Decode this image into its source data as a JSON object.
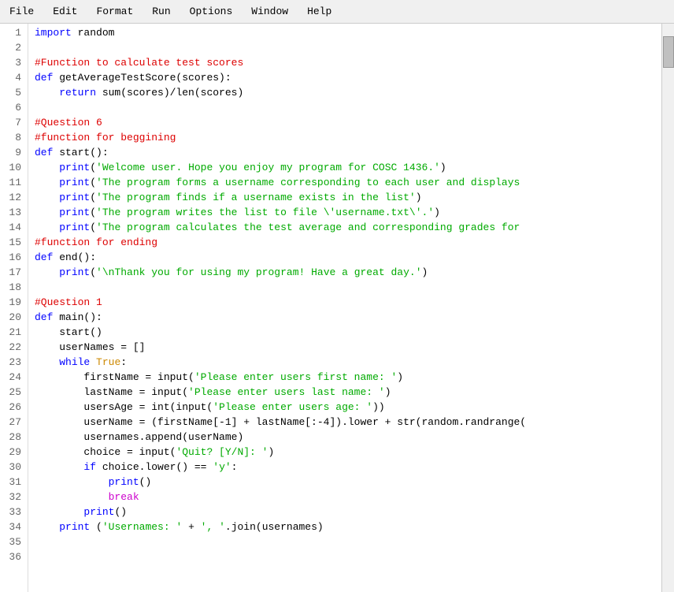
{
  "menubar": {
    "items": [
      "File",
      "Edit",
      "Format",
      "Run",
      "Options",
      "Window",
      "Help"
    ]
  },
  "editor": {
    "lines": [
      {
        "num": 1,
        "tokens": [
          {
            "type": "kw-blue",
            "text": "import"
          },
          {
            "type": "fn-black",
            "text": " random"
          }
        ]
      },
      {
        "num": 2,
        "tokens": []
      },
      {
        "num": 3,
        "tokens": [
          {
            "type": "comment-red",
            "text": "#Function to calculate test scores"
          }
        ]
      },
      {
        "num": 4,
        "tokens": [
          {
            "type": "kw-blue",
            "text": "def"
          },
          {
            "type": "fn-black",
            "text": " getAverageTestScore(scores):"
          }
        ]
      },
      {
        "num": 5,
        "tokens": [
          {
            "type": "fn-black",
            "text": "    "
          },
          {
            "type": "kw-blue",
            "text": "return"
          },
          {
            "type": "fn-black",
            "text": " sum(scores)/len(scores)"
          }
        ]
      },
      {
        "num": 6,
        "tokens": []
      },
      {
        "num": 7,
        "tokens": [
          {
            "type": "comment-red",
            "text": "#Question 6"
          }
        ]
      },
      {
        "num": 8,
        "tokens": [
          {
            "type": "comment-red",
            "text": "#function for beggining"
          }
        ]
      },
      {
        "num": 9,
        "tokens": [
          {
            "type": "kw-blue",
            "text": "def"
          },
          {
            "type": "fn-black",
            "text": " start():"
          }
        ]
      },
      {
        "num": 10,
        "tokens": [
          {
            "type": "fn-black",
            "text": "    "
          },
          {
            "type": "kw-blue",
            "text": "print"
          },
          {
            "type": "fn-black",
            "text": "("
          },
          {
            "type": "str-green",
            "text": "'Welcome user. Hope you enjoy my program for COSC 1436.'"
          },
          {
            "type": "fn-black",
            "text": ")"
          }
        ]
      },
      {
        "num": 11,
        "tokens": [
          {
            "type": "fn-black",
            "text": "    "
          },
          {
            "type": "kw-blue",
            "text": "print"
          },
          {
            "type": "fn-black",
            "text": "("
          },
          {
            "type": "str-green",
            "text": "'The program forms a username corresponding to each user and displays"
          },
          {
            "type": "fn-black",
            "text": ""
          }
        ]
      },
      {
        "num": 12,
        "tokens": [
          {
            "type": "fn-black",
            "text": "    "
          },
          {
            "type": "kw-blue",
            "text": "print"
          },
          {
            "type": "fn-black",
            "text": "("
          },
          {
            "type": "str-green",
            "text": "'The program finds if a username exists in the list'"
          },
          {
            "type": "fn-black",
            "text": ")"
          }
        ]
      },
      {
        "num": 13,
        "tokens": [
          {
            "type": "fn-black",
            "text": "    "
          },
          {
            "type": "kw-blue",
            "text": "print"
          },
          {
            "type": "fn-black",
            "text": "("
          },
          {
            "type": "str-green",
            "text": "'The program writes the list to file \\'username.txt\\'.'"
          },
          {
            "type": "fn-black",
            "text": ")"
          }
        ]
      },
      {
        "num": 14,
        "tokens": [
          {
            "type": "fn-black",
            "text": "    "
          },
          {
            "type": "kw-blue",
            "text": "print"
          },
          {
            "type": "fn-black",
            "text": "("
          },
          {
            "type": "str-green",
            "text": "'The program calculates the test average and corresponding grades for"
          },
          {
            "type": "fn-black",
            "text": ""
          }
        ]
      },
      {
        "num": 15,
        "tokens": [
          {
            "type": "comment-red",
            "text": "#function for ending"
          }
        ]
      },
      {
        "num": 16,
        "tokens": [
          {
            "type": "kw-blue",
            "text": "def"
          },
          {
            "type": "fn-black",
            "text": " end():"
          }
        ]
      },
      {
        "num": 17,
        "tokens": [
          {
            "type": "fn-black",
            "text": "    "
          },
          {
            "type": "kw-blue",
            "text": "print"
          },
          {
            "type": "fn-black",
            "text": "("
          },
          {
            "type": "str-green",
            "text": "'\\nThank you for using my program! Have a great day.'"
          },
          {
            "type": "fn-black",
            "text": ")"
          }
        ]
      },
      {
        "num": 18,
        "tokens": []
      },
      {
        "num": 19,
        "tokens": [
          {
            "type": "comment-red",
            "text": "#Question 1"
          }
        ]
      },
      {
        "num": 20,
        "tokens": [
          {
            "type": "kw-blue",
            "text": "def"
          },
          {
            "type": "fn-black",
            "text": " main():"
          }
        ]
      },
      {
        "num": 21,
        "tokens": [
          {
            "type": "fn-black",
            "text": "    start()"
          }
        ]
      },
      {
        "num": 22,
        "tokens": [
          {
            "type": "fn-black",
            "text": "    userNames = []"
          }
        ]
      },
      {
        "num": 23,
        "tokens": [
          {
            "type": "fn-black",
            "text": "    "
          },
          {
            "type": "kw-blue",
            "text": "while"
          },
          {
            "type": "fn-black",
            "text": " "
          },
          {
            "type": "kw-orange",
            "text": "True"
          },
          {
            "type": "fn-black",
            "text": ":"
          }
        ]
      },
      {
        "num": 24,
        "tokens": [
          {
            "type": "fn-black",
            "text": "        firstName = input("
          },
          {
            "type": "str-green",
            "text": "'Please enter users first name: '"
          },
          {
            "type": "fn-black",
            "text": ")"
          }
        ]
      },
      {
        "num": 25,
        "tokens": [
          {
            "type": "fn-black",
            "text": "        lastName = input("
          },
          {
            "type": "str-green",
            "text": "'Please enter users last name: '"
          },
          {
            "type": "fn-black",
            "text": ")"
          }
        ]
      },
      {
        "num": 26,
        "tokens": [
          {
            "type": "fn-black",
            "text": "        usersAge = int(input("
          },
          {
            "type": "str-green",
            "text": "'Please enter users age: '"
          },
          {
            "type": "fn-black",
            "text": "))"
          }
        ]
      },
      {
        "num": 27,
        "tokens": [
          {
            "type": "fn-black",
            "text": "        userName = (firstName[-1] + lastName[:-4]).lower + str(random.randrange("
          }
        ]
      },
      {
        "num": 28,
        "tokens": [
          {
            "type": "fn-black",
            "text": "        usernames.append(userName)"
          }
        ]
      },
      {
        "num": 29,
        "tokens": [
          {
            "type": "fn-black",
            "text": "        choice = input("
          },
          {
            "type": "str-green",
            "text": "'Quit? [Y/N]: '"
          },
          {
            "type": "fn-black",
            "text": ")"
          }
        ]
      },
      {
        "num": 30,
        "tokens": [
          {
            "type": "fn-black",
            "text": "        "
          },
          {
            "type": "kw-blue",
            "text": "if"
          },
          {
            "type": "fn-black",
            "text": " choice.lower() == "
          },
          {
            "type": "str-green",
            "text": "'y'"
          },
          {
            "type": "fn-black",
            "text": ":"
          }
        ]
      },
      {
        "num": 31,
        "tokens": [
          {
            "type": "fn-black",
            "text": "            "
          },
          {
            "type": "kw-blue",
            "text": "print"
          },
          {
            "type": "fn-black",
            "text": "()"
          }
        ]
      },
      {
        "num": 32,
        "tokens": [
          {
            "type": "fn-black",
            "text": "            "
          },
          {
            "type": "kw-purple",
            "text": "break"
          }
        ]
      },
      {
        "num": 33,
        "tokens": [
          {
            "type": "fn-black",
            "text": "        "
          },
          {
            "type": "kw-blue",
            "text": "print"
          },
          {
            "type": "fn-black",
            "text": "()"
          }
        ]
      },
      {
        "num": 34,
        "tokens": [
          {
            "type": "fn-black",
            "text": "    "
          },
          {
            "type": "kw-blue",
            "text": "print"
          },
          {
            "type": "fn-black",
            "text": " ("
          },
          {
            "type": "str-green",
            "text": "'Usernames: '"
          },
          {
            "type": "fn-black",
            "text": " + "
          },
          {
            "type": "str-green",
            "text": "', '"
          },
          {
            "type": "fn-black",
            "text": ".join(usernames)"
          }
        ]
      },
      {
        "num": 35,
        "tokens": []
      },
      {
        "num": 36,
        "tokens": []
      }
    ]
  }
}
